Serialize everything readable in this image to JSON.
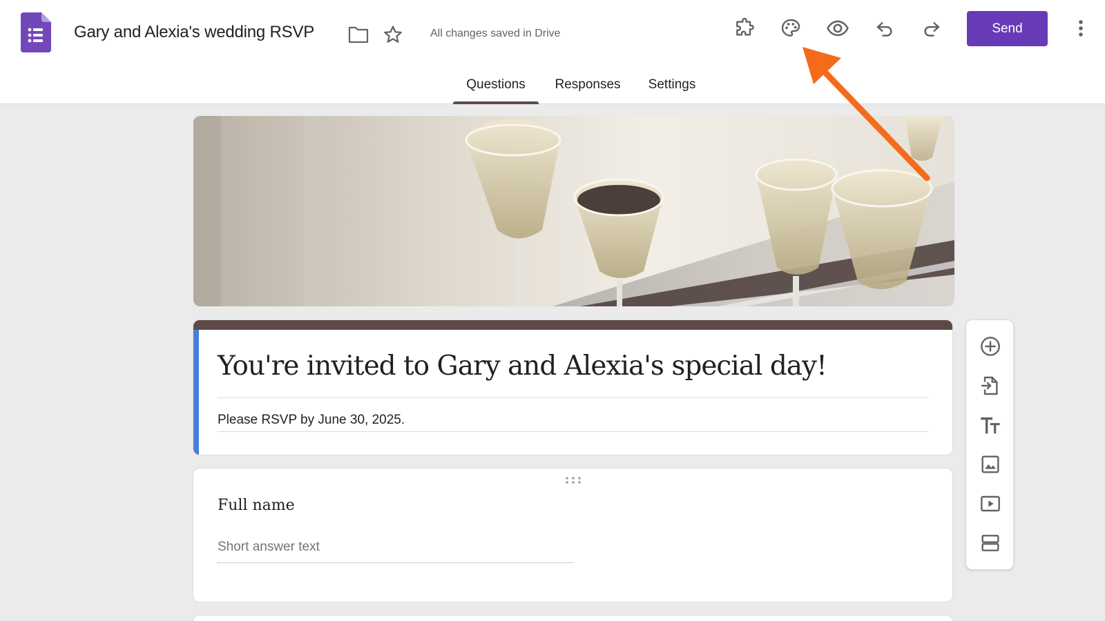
{
  "app": {
    "logo_icon": "google-forms-icon",
    "accent_color": "#673ab7",
    "theme_color": "#5d4a46",
    "highlight_color": "#4a7dda"
  },
  "header": {
    "title": "Gary and Alexia's wedding RSVP",
    "save_status": "All changes saved in Drive",
    "send_label": "Send",
    "icons": {
      "folder": "folder-icon",
      "star": "star-icon",
      "addons": "puzzle-icon",
      "customize_theme": "palette-icon",
      "preview": "eye-icon",
      "undo": "undo-icon",
      "redo": "redo-icon",
      "more": "more-vert-icon"
    }
  },
  "tabs": [
    {
      "label": "Questions",
      "active": true
    },
    {
      "label": "Responses",
      "active": false
    },
    {
      "label": "Settings",
      "active": false
    }
  ],
  "banner": {
    "image": "champagne-glasses-header-image"
  },
  "form": {
    "title": "You're invited to Gary and Alexia's special day!",
    "description": "Please RSVP by June 30, 2025."
  },
  "questions": [
    {
      "title": "Full name",
      "placeholder": "Short answer text"
    }
  ],
  "side_toolbar": {
    "icons": [
      "add-question-icon",
      "import-questions-icon",
      "add-title-icon",
      "add-image-icon",
      "add-video-icon",
      "add-section-icon"
    ]
  },
  "annotation": {
    "arrow_color": "#f46b1c",
    "points_to": "palette-icon"
  }
}
